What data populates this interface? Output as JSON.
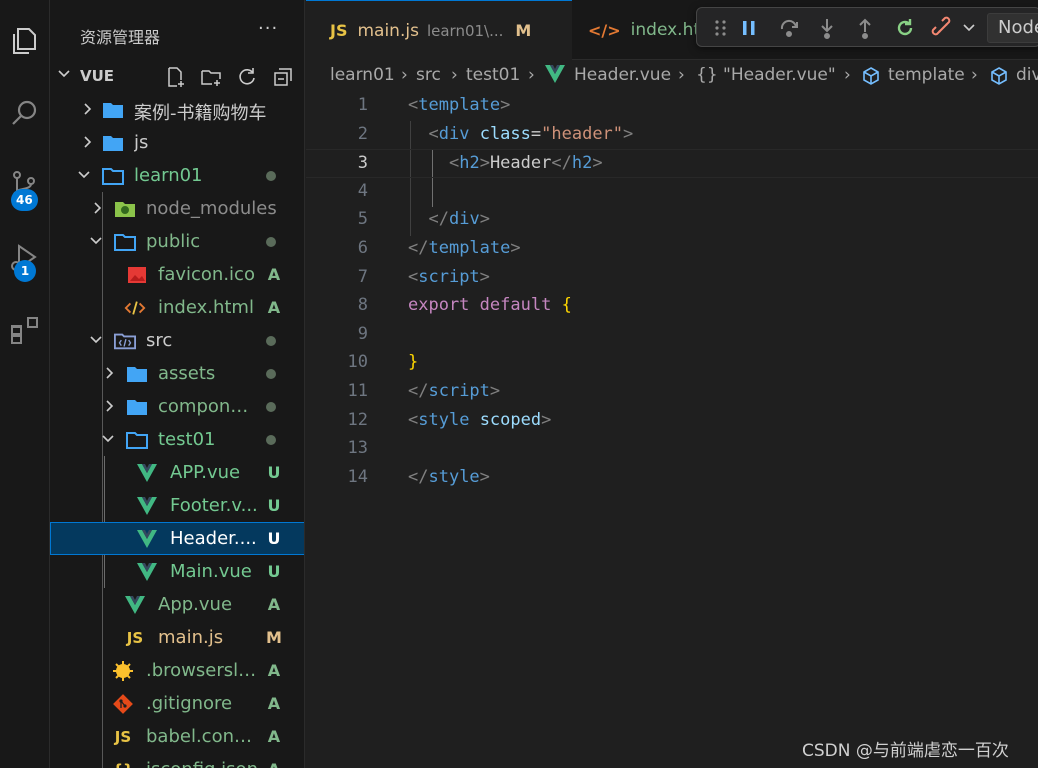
{
  "sidebar": {
    "title": "资源管理器",
    "more": "···",
    "section_label": "VUE",
    "items": [
      {
        "name": "案例-书籍购物车",
        "status": ""
      },
      {
        "name": "js",
        "status": ""
      },
      {
        "name": "learn01",
        "status": ""
      },
      {
        "name": "node_modules",
        "status": ""
      },
      {
        "name": "public",
        "status": ""
      },
      {
        "name": "favicon.ico",
        "status": "A"
      },
      {
        "name": "index.html",
        "status": "A"
      },
      {
        "name": "src",
        "status": ""
      },
      {
        "name": "assets",
        "status": ""
      },
      {
        "name": "compone...",
        "status": ""
      },
      {
        "name": "test01",
        "status": ""
      },
      {
        "name": "APP.vue",
        "status": "U"
      },
      {
        "name": "Footer.v...",
        "status": "U"
      },
      {
        "name": "Header....",
        "status": "U"
      },
      {
        "name": "Main.vue",
        "status": "U"
      },
      {
        "name": "App.vue",
        "status": "A"
      },
      {
        "name": "main.js",
        "status": "M"
      },
      {
        "name": ".browserslis...",
        "status": "A"
      },
      {
        "name": ".gitignore",
        "status": "A"
      },
      {
        "name": "babel.confi...",
        "status": "A"
      },
      {
        "name": "jsconfig.json",
        "status": "A"
      }
    ]
  },
  "activity": {
    "source_control_badge": "46",
    "run_debug_badge": "1"
  },
  "tabs": [
    {
      "icon": "JS",
      "name": "main.js",
      "desc": "learn01\\...",
      "modified": "M"
    },
    {
      "icon": "</>",
      "name": "index.html",
      "desc": "",
      "modified": ""
    }
  ],
  "debug": {
    "target": "Node"
  },
  "breadcrumb": [
    "learn01",
    "src",
    "test01",
    "Header.vue",
    "{} \"Header.vue\"",
    "template",
    "div"
  ],
  "editor": {
    "line_numbers": [
      "1",
      "2",
      "3",
      "4",
      "5",
      "6",
      "7",
      "8",
      "9",
      "10",
      "11",
      "12",
      "13",
      "14"
    ],
    "lines": {
      "l1_tag": "template",
      "l2_tag": "div",
      "l2_attr": "class",
      "l2_val": "\"header\"",
      "l3_tag": "h2",
      "l3_text": "Header",
      "l3_close": "h2",
      "l5_close": "div",
      "l6_close": "template",
      "l7_tag": "script",
      "l8_kw1": "export",
      "l8_kw2": "default",
      "l8_brace": "{",
      "l10_brace": "}",
      "l11_close": "script",
      "l12_tag": "style",
      "l12_attr": "scoped",
      "l14_close": "style"
    }
  },
  "watermark": "CSDN @与前端虐恋一百次",
  "colors": {
    "accent": "#0078d4",
    "vue_green": "#41b883",
    "folder_blue": "#42a5f5",
    "js_yellow": "#e8c345",
    "untracked_green": "#73c991",
    "added_green": "#81b88b",
    "modified_amber": "#e2c08d"
  }
}
